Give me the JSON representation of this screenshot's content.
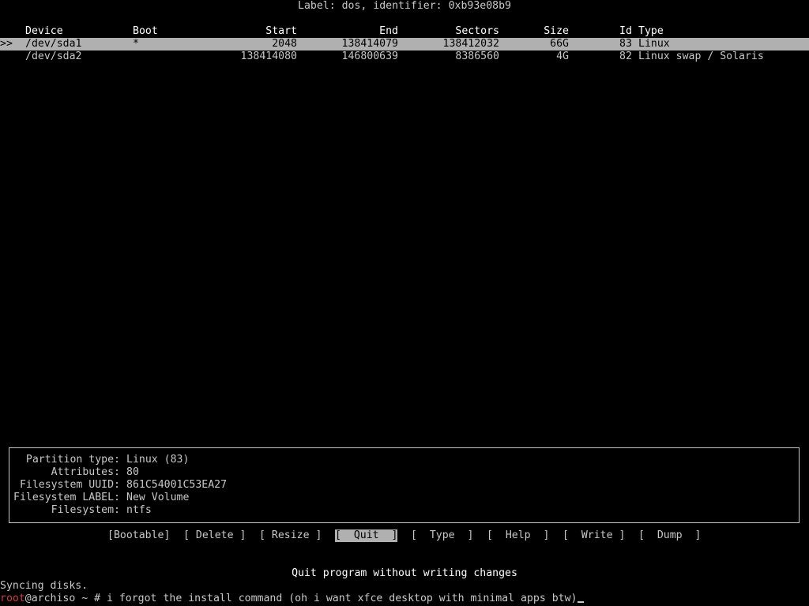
{
  "disk_label": "Label: dos, identifier: 0xb93e08b9",
  "columns": {
    "device": "Device",
    "boot": "Boot",
    "start": "Start",
    "end": "End",
    "sectors": "Sectors",
    "size": "Size",
    "id": "Id",
    "type": "Type"
  },
  "partitions": [
    {
      "marker": ">>",
      "device": "/dev/sda1",
      "boot": "*",
      "start": "2048",
      "end": "138414079",
      "sectors": "138412032",
      "size": "66G",
      "id": "83",
      "type": "Linux"
    },
    {
      "marker": "",
      "device": "/dev/sda2",
      "boot": "",
      "start": "138414080",
      "end": "146800639",
      "sectors": "8386560",
      "size": "4G",
      "id": "82",
      "type": "Linux swap / Solaris"
    }
  ],
  "info": {
    "partition_type_label": "Partition type:",
    "partition_type_value": "Linux (83)",
    "attributes_label": "Attributes:",
    "attributes_value": "80",
    "uuid_label": "Filesystem UUID:",
    "uuid_value": "861C54001C53EA27",
    "fslabel_label": "Filesystem LABEL:",
    "fslabel_value": "New Volume",
    "filesystem_label": "Filesystem:",
    "filesystem_value": "ntfs"
  },
  "menu": {
    "bootable": "[Bootable]",
    "delete": "[ Delete ]",
    "resize": "[ Resize ]",
    "quit": "[  Quit  ]",
    "type": "[  Type  ]",
    "help": "[  Help  ]",
    "write": "[  Write ]",
    "dump": "[  Dump  ]",
    "selected": "quit"
  },
  "status_message": "Quit program without writing changes",
  "console": {
    "sync_line": "Syncing disks.",
    "prompt_user": "root",
    "prompt_rest": "@archiso ~ # ",
    "command": "i forgot the install command (oh i want xfce desktop with minimal apps btw)"
  },
  "colors": {
    "background": "#000000",
    "text": "#c8c8c8",
    "selection": "#b0b0b0",
    "prompt_user": "#d23c3c"
  }
}
